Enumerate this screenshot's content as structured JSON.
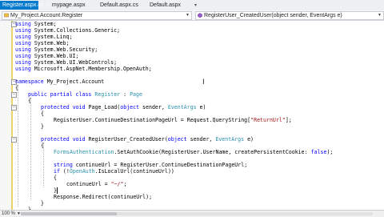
{
  "tabs": [
    {
      "label": "Register.aspx.cs",
      "active": true
    },
    {
      "label": "mypage.aspx",
      "active": false
    },
    {
      "label": "Default.aspx.cs",
      "active": false
    },
    {
      "label": "Default.aspx",
      "active": false
    }
  ],
  "navbar": {
    "class_selector": "My_Project.Account.Register",
    "member_selector": "RegisterUser_CreatedUser(object sender, EventArgs e)"
  },
  "code": {
    "l1": [
      "using",
      " System;"
    ],
    "l2": [
      "using",
      " System.Collections.Generic;"
    ],
    "l3": [
      "using",
      " System.Linq;"
    ],
    "l4": [
      "using",
      " System.Web;"
    ],
    "l5": [
      "using",
      " System.Web.Security;"
    ],
    "l6": [
      "using",
      " System.Web.UI;"
    ],
    "l7": [
      "using",
      " System.Web.UI.WebControls;"
    ],
    "l8": [
      "using",
      " Microsoft.AspNet.Membership.OpenAuth;"
    ],
    "l10": [
      "namespace",
      " My_Project.Account"
    ],
    "l11": "{",
    "l12": [
      "public partial class",
      " ",
      "Register",
      " : ",
      "Page"
    ],
    "l13": "{",
    "l14": [
      "protected void",
      " Page_Load(",
      "object",
      " sender, ",
      "EventArgs",
      " e)"
    ],
    "l15": "{",
    "l16": [
      "RegisterUser.ContinueDestinationPageUrl = Request.QueryString[",
      "\"ReturnUrl\"",
      "];"
    ],
    "l17": "}",
    "l19": [
      "protected void",
      " RegisterUser_CreatedUser(",
      "object",
      " sender, ",
      "EventArgs",
      " e)"
    ],
    "l20": "{",
    "l21": [
      "FormsAuthentication",
      ".SetAuthCookie(RegisterUser.UserName, createPersistentCookie: ",
      "false",
      ");"
    ],
    "l23": [
      "string",
      " continueUrl = RegisterUser.ContinueDestinationPageUrl;"
    ],
    "l24": [
      "if",
      " (!",
      "OpenAuth",
      ".IsLocalUrl(continueUrl))"
    ],
    "l25": "{",
    "l26": [
      "continueUrl = ",
      "\"~/\"",
      ";"
    ],
    "l27": "}",
    "l28": "Response.Redirect(continueUrl);",
    "l29": "}",
    "l30": "}"
  },
  "statusbar": {
    "zoom": "100 %"
  },
  "icons": {
    "tab_close": "close-icon",
    "tab_pin": "pin-icon",
    "dropdown": "chevron-down-icon",
    "mouse": "i-beam-cursor-icon"
  },
  "colors": {
    "keyword": "#0000ff",
    "type": "#2b91af",
    "string": "#a31515",
    "active_tab": "#007acc"
  }
}
